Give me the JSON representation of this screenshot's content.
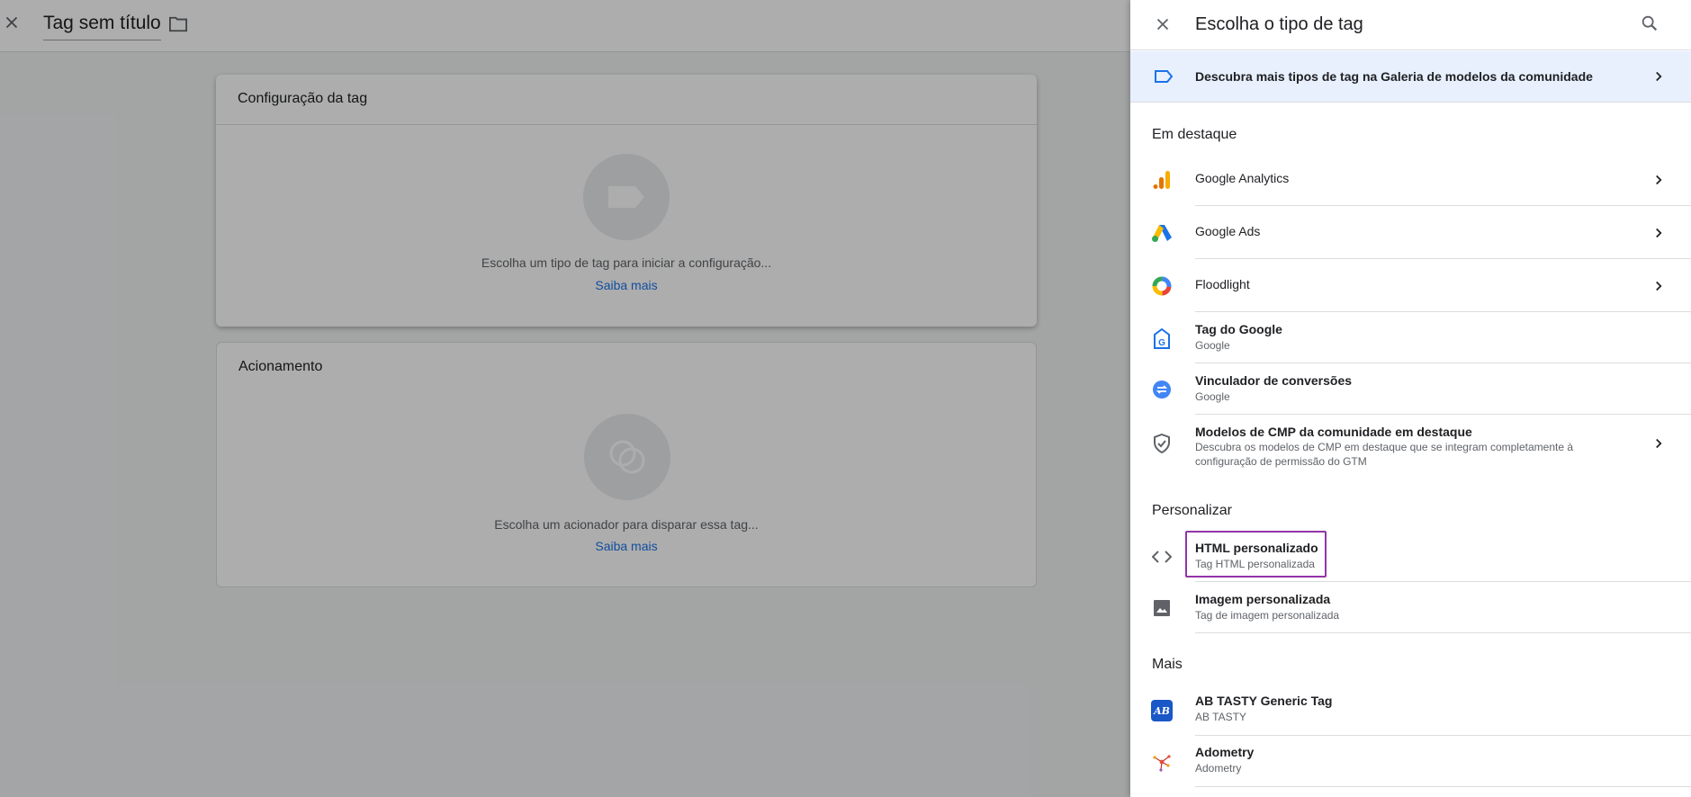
{
  "editor": {
    "title": "Tag sem título",
    "config_card": {
      "title": "Configuração da tag",
      "hint": "Escolha um tipo de tag para iniciar a configuração...",
      "learn_more": "Saiba mais"
    },
    "trigger_card": {
      "title": "Acionamento",
      "hint": "Escolha um acionador para disparar essa tag...",
      "learn_more": "Saiba mais"
    }
  },
  "panel": {
    "title": "Escolha o tipo de tag",
    "banner": "Descubra mais tipos de tag na Galeria de modelos da comunidade",
    "sections": {
      "featured": "Em destaque",
      "custom": "Personalizar",
      "more": "Mais"
    },
    "featured": [
      {
        "title": "Google Analytics",
        "icon": "google-analytics-icon"
      },
      {
        "title": "Google Ads",
        "icon": "google-ads-icon"
      },
      {
        "title": "Floodlight",
        "icon": "floodlight-icon"
      },
      {
        "title": "Tag do Google",
        "subtitle": "Google",
        "icon": "google-tag-icon"
      },
      {
        "title": "Vinculador de conversões",
        "subtitle": "Google",
        "icon": "conversion-linker-icon"
      },
      {
        "title": "Modelos de CMP da comunidade em destaque",
        "subtitle": "Descubra os modelos de CMP em destaque que se integram completamente à",
        "subtitle2": "configuração de permissão do GTM",
        "icon": "shield-check-icon"
      }
    ],
    "custom": [
      {
        "title": "HTML personalizado",
        "subtitle": "Tag HTML personalizada",
        "icon": "code-icon"
      },
      {
        "title": "Imagem personalizada",
        "subtitle": "Tag de imagem personalizada",
        "icon": "image-icon"
      }
    ],
    "more": [
      {
        "title": "AB TASTY Generic Tag",
        "subtitle": "AB TASTY",
        "icon": "ab-tasty-icon",
        "logo_text": "AB"
      },
      {
        "title": "Adometry",
        "subtitle": "Adometry",
        "icon": "adometry-icon"
      }
    ]
  },
  "colors": {
    "accent_blue": "#1a73e8",
    "highlight_purple": "#9334a8",
    "banner_bg": "#e8f0fe"
  }
}
